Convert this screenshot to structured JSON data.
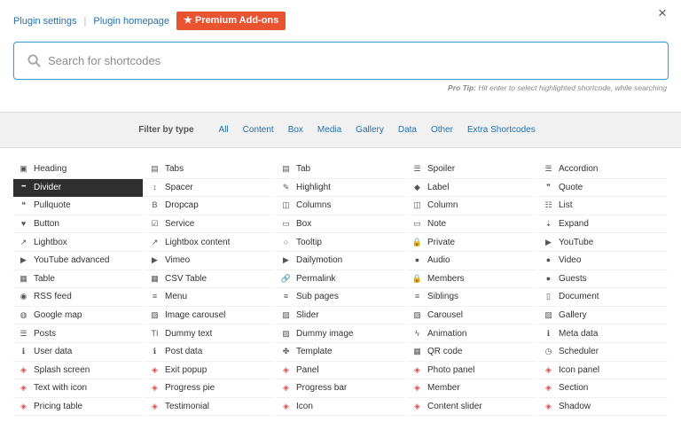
{
  "header": {
    "plugin_settings": "Plugin settings",
    "plugin_homepage": "Plugin homepage",
    "separator": "|",
    "premium_label": "★ Premium Add-ons",
    "close_glyph": "×"
  },
  "search": {
    "placeholder": "Search for shortcodes",
    "pro_tip_label": "Pro Tip:",
    "pro_tip_text": " Hit enter to select highlighted shortcode, while searching"
  },
  "filter": {
    "label": "Filter by type",
    "types": [
      "All",
      "Content",
      "Box",
      "Media",
      "Gallery",
      "Data",
      "Other",
      "Extra Shortcodes"
    ]
  },
  "colors": {
    "link": "#2271b1",
    "premium": "#e9532f",
    "search_border": "#3b9dd4",
    "active_bg": "#2f2f2f",
    "addon_icon": "#d9534f"
  },
  "shortcodes": [
    {
      "label": "Heading",
      "icon": "heading-icon",
      "glyph": "▣"
    },
    {
      "label": "Tabs",
      "icon": "tabs-icon",
      "glyph": "▤"
    },
    {
      "label": "Tab",
      "icon": "tab-icon",
      "glyph": "▤"
    },
    {
      "label": "Spoiler",
      "icon": "list-ul-icon",
      "glyph": "☰"
    },
    {
      "label": "Accordion",
      "icon": "list-ul-icon",
      "glyph": "☰"
    },
    {
      "label": "Divider",
      "icon": "ellipsis-icon",
      "glyph": "•••",
      "active": true
    },
    {
      "label": "Spacer",
      "icon": "arrows-v-icon",
      "glyph": "↕"
    },
    {
      "label": "Highlight",
      "icon": "pencil-icon",
      "glyph": "✎"
    },
    {
      "label": "Label",
      "icon": "tag-icon",
      "glyph": "◆"
    },
    {
      "label": "Quote",
      "icon": "quote-icon",
      "glyph": "❞"
    },
    {
      "label": "Pullquote",
      "icon": "quote-icon",
      "glyph": "❝"
    },
    {
      "label": "Dropcap",
      "icon": "bold-icon",
      "glyph": "B"
    },
    {
      "label": "Columns",
      "icon": "columns-icon",
      "glyph": "◫"
    },
    {
      "label": "Column",
      "icon": "columns-icon",
      "glyph": "◫"
    },
    {
      "label": "List",
      "icon": "list-ol-icon",
      "glyph": "☷"
    },
    {
      "label": "Button",
      "icon": "heart-icon",
      "glyph": "♥"
    },
    {
      "label": "Service",
      "icon": "check-square-icon",
      "glyph": "☑"
    },
    {
      "label": "Box",
      "icon": "box-icon",
      "glyph": "▭"
    },
    {
      "label": "Note",
      "icon": "note-icon",
      "glyph": "▭"
    },
    {
      "label": "Expand",
      "icon": "sort-amount-icon",
      "glyph": "⇣"
    },
    {
      "label": "Lightbox",
      "icon": "external-link-icon",
      "glyph": "↗"
    },
    {
      "label": "Lightbox content",
      "icon": "external-link-icon",
      "glyph": "↗"
    },
    {
      "label": "Tooltip",
      "icon": "comment-icon",
      "glyph": "○"
    },
    {
      "label": "Private",
      "icon": "lock-icon",
      "glyph": "🔒"
    },
    {
      "label": "YouTube",
      "icon": "youtube-icon",
      "glyph": "▶"
    },
    {
      "label": "YouTube advanced",
      "icon": "youtube-icon",
      "glyph": "▶"
    },
    {
      "label": "Vimeo",
      "icon": "vimeo-icon",
      "glyph": "▶"
    },
    {
      "label": "Dailymotion",
      "icon": "play-icon",
      "glyph": "▶"
    },
    {
      "label": "Audio",
      "icon": "play-circle-icon",
      "glyph": "●"
    },
    {
      "label": "Video",
      "icon": "play-circle-icon",
      "glyph": "●"
    },
    {
      "label": "Table",
      "icon": "table-icon",
      "glyph": "▦"
    },
    {
      "label": "CSV Table",
      "icon": "table-icon",
      "glyph": "▦"
    },
    {
      "label": "Permalink",
      "icon": "link-icon",
      "glyph": "🔗"
    },
    {
      "label": "Members",
      "icon": "lock-icon",
      "glyph": "🔒"
    },
    {
      "label": "Guests",
      "icon": "user-icon",
      "glyph": "●"
    },
    {
      "label": "RSS feed",
      "icon": "rss-icon",
      "glyph": "◉"
    },
    {
      "label": "Menu",
      "icon": "bars-icon",
      "glyph": "≡"
    },
    {
      "label": "Sub pages",
      "icon": "bars-icon",
      "glyph": "≡"
    },
    {
      "label": "Siblings",
      "icon": "bars-icon",
      "glyph": "≡"
    },
    {
      "label": "Document",
      "icon": "file-icon",
      "glyph": "▯"
    },
    {
      "label": "Google map",
      "icon": "globe-icon",
      "glyph": "◍"
    },
    {
      "label": "Image carousel",
      "icon": "picture-icon",
      "glyph": "▨"
    },
    {
      "label": "Slider",
      "icon": "picture-icon",
      "glyph": "▨"
    },
    {
      "label": "Carousel",
      "icon": "picture-icon",
      "glyph": "▨"
    },
    {
      "label": "Gallery",
      "icon": "picture-icon",
      "glyph": "▨"
    },
    {
      "label": "Posts",
      "icon": "th-list-icon",
      "glyph": "☰"
    },
    {
      "label": "Dummy text",
      "icon": "text-height-icon",
      "glyph": "TI"
    },
    {
      "label": "Dummy image",
      "icon": "picture-icon",
      "glyph": "▨"
    },
    {
      "label": "Animation",
      "icon": "bolt-icon",
      "glyph": "ϟ"
    },
    {
      "label": "Meta data",
      "icon": "info-circle-icon",
      "glyph": "ℹ"
    },
    {
      "label": "User data",
      "icon": "info-circle-icon",
      "glyph": "ℹ"
    },
    {
      "label": "Post data",
      "icon": "info-circle-icon",
      "glyph": "ℹ"
    },
    {
      "label": "Template",
      "icon": "puzzle-icon",
      "glyph": "✤"
    },
    {
      "label": "QR code",
      "icon": "qrcode-icon",
      "glyph": "▦"
    },
    {
      "label": "Scheduler",
      "icon": "clock-icon",
      "glyph": "◷"
    },
    {
      "label": "Splash screen",
      "icon": "stack-addon-icon",
      "glyph": "◈",
      "addon": true
    },
    {
      "label": "Exit popup",
      "icon": "stack-addon-icon",
      "glyph": "◈",
      "addon": true
    },
    {
      "label": "Panel",
      "icon": "stack-addon-icon",
      "glyph": "◈",
      "addon": true
    },
    {
      "label": "Photo panel",
      "icon": "stack-addon-icon",
      "glyph": "◈",
      "addon": true
    },
    {
      "label": "Icon panel",
      "icon": "stack-addon-icon",
      "glyph": "◈",
      "addon": true
    },
    {
      "label": "Text with icon",
      "icon": "stack-addon-icon",
      "glyph": "◈",
      "addon": true
    },
    {
      "label": "Progress pie",
      "icon": "stack-addon-icon",
      "glyph": "◈",
      "addon": true
    },
    {
      "label": "Progress bar",
      "icon": "stack-addon-icon",
      "glyph": "◈",
      "addon": true
    },
    {
      "label": "Member",
      "icon": "stack-addon-icon",
      "glyph": "◈",
      "addon": true
    },
    {
      "label": "Section",
      "icon": "stack-addon-icon",
      "glyph": "◈",
      "addon": true
    },
    {
      "label": "Pricing table",
      "icon": "stack-addon-icon",
      "glyph": "◈",
      "addon": true
    },
    {
      "label": "Testimonial",
      "icon": "stack-addon-icon",
      "glyph": "◈",
      "addon": true
    },
    {
      "label": "Icon",
      "icon": "stack-addon-icon",
      "glyph": "◈",
      "addon": true
    },
    {
      "label": "Content slider",
      "icon": "stack-addon-icon",
      "glyph": "◈",
      "addon": true
    },
    {
      "label": "Shadow",
      "icon": "stack-addon-icon",
      "glyph": "◈",
      "addon": true
    }
  ]
}
